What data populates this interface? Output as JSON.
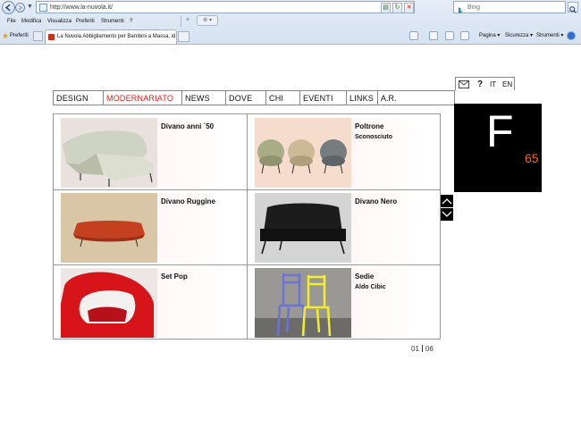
{
  "browser": {
    "address": "http://www.la-nuvola.it/",
    "search_placeholder": "Bing",
    "menu": [
      "File",
      "Modifica",
      "Visualizza",
      "Preferiti",
      "Strumenti",
      "?"
    ],
    "favorites_label": "Preferiti",
    "tab_title": "La Nuvola Abbigliamento per Bambini a Massa, idee re...",
    "commands": {
      "page": "Pagina ▾",
      "security": "Sicurezza ▾",
      "tools": "Strumenti ▾"
    },
    "close_glyph": "×"
  },
  "site": {
    "nav": [
      "DESIGN",
      "MODERNARIATO",
      "NEWS",
      "DOVE",
      "CHI",
      "EVENTI",
      "LINKS",
      "A.R."
    ],
    "active_nav": "MODERNARIATO",
    "help": "?",
    "lang": [
      "IT",
      "EN"
    ],
    "brand_letter": "F",
    "brand_number": "65",
    "items": [
      {
        "title": "Divano anni `50",
        "subtitle": ""
      },
      {
        "title": "Poltrone",
        "subtitle": "Sconosciuto"
      },
      {
        "title": "Divano Ruggine",
        "subtitle": ""
      },
      {
        "title": "Divano Nero",
        "subtitle": ""
      },
      {
        "title": "Set Pop",
        "subtitle": ""
      },
      {
        "title": "Sedie",
        "subtitle": "Aldo Cibic"
      }
    ],
    "pager": {
      "current": "01",
      "total": "06"
    }
  },
  "colors": {
    "accent": "#e11b16",
    "brand_number": "#f26a1f"
  }
}
